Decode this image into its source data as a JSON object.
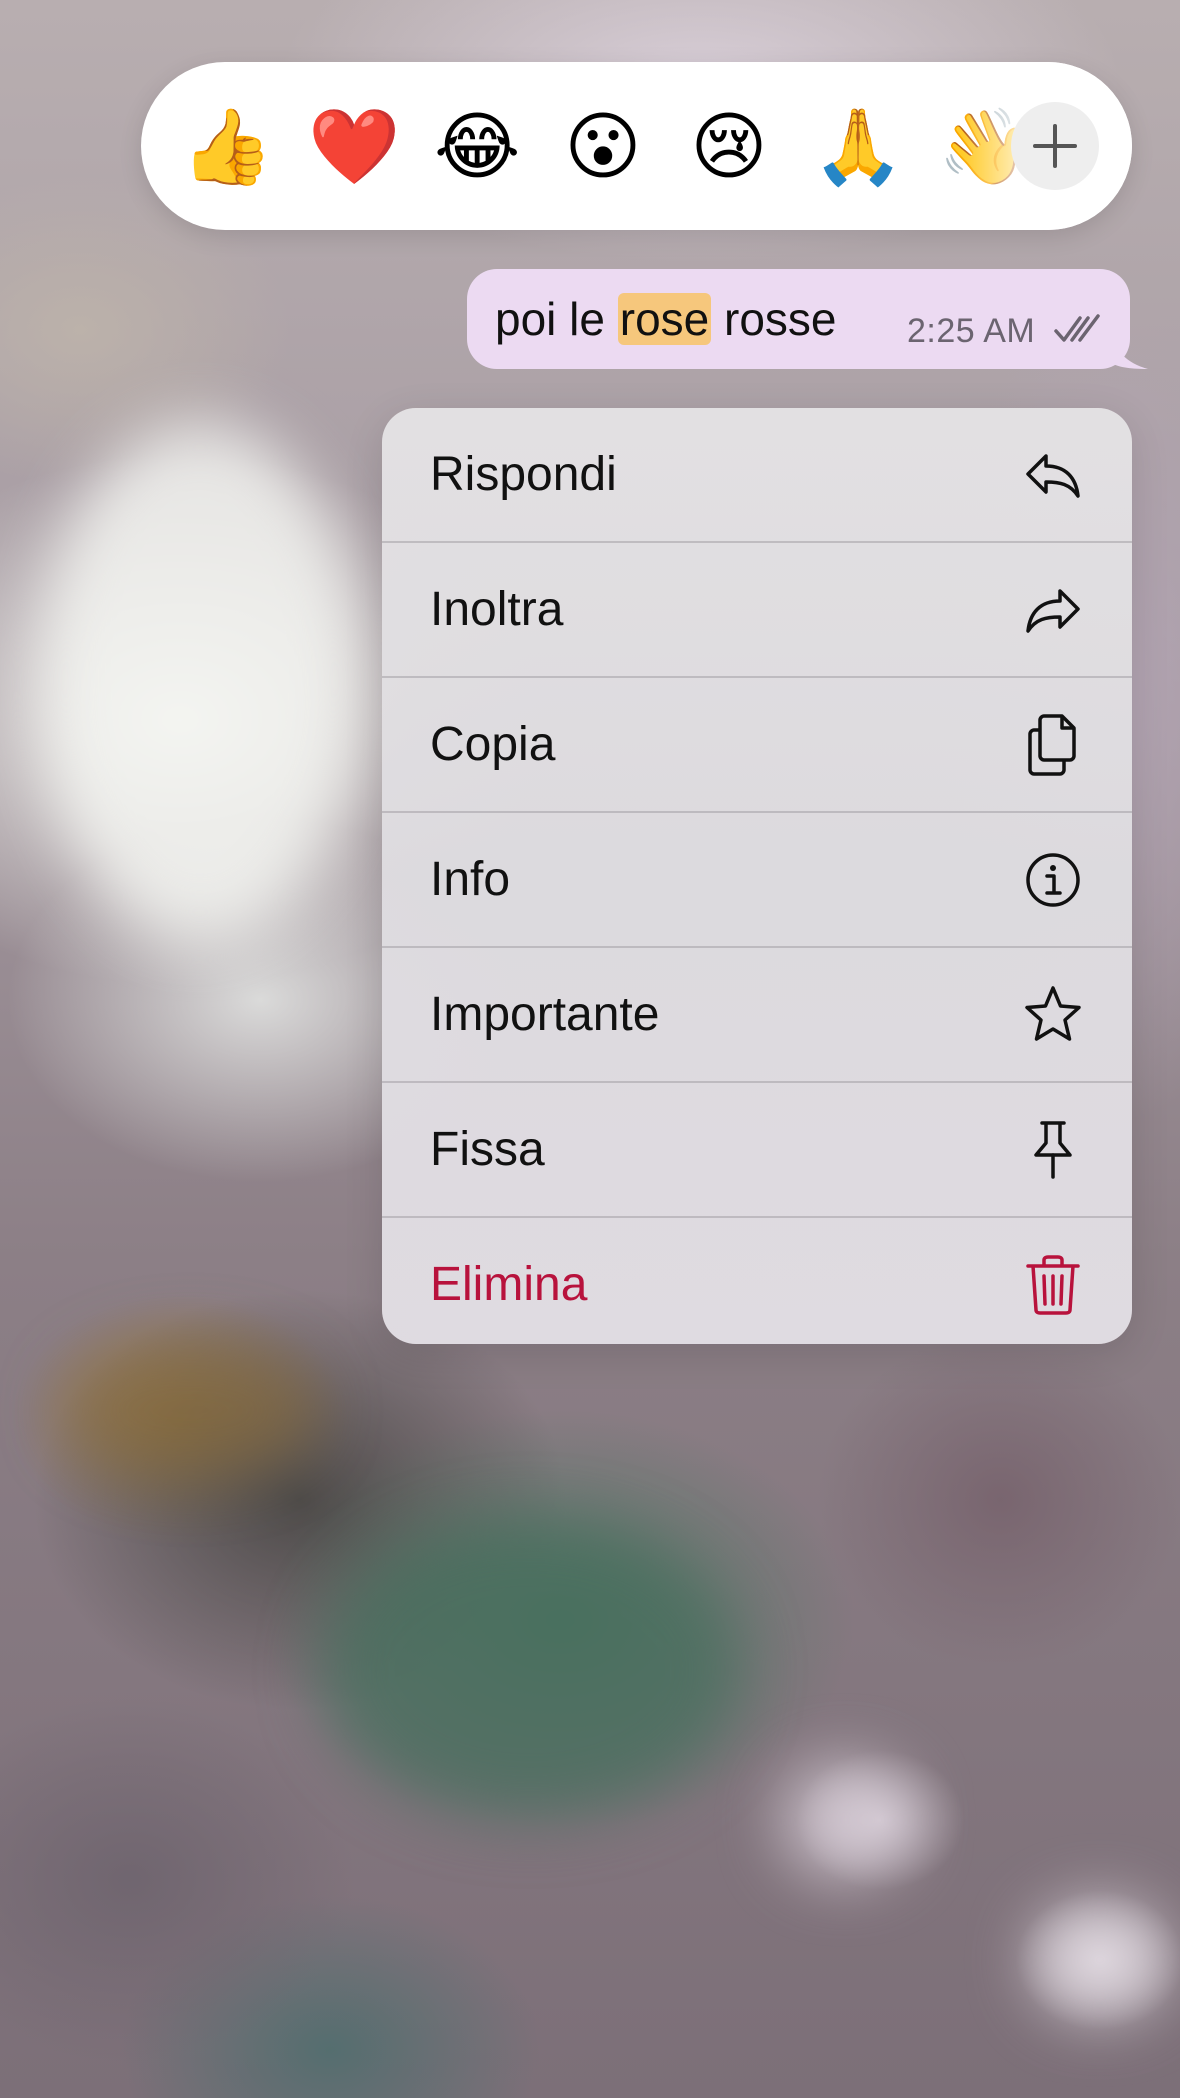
{
  "reactions": {
    "emojis": [
      {
        "name": "thumbs-up",
        "glyph": "👍"
      },
      {
        "name": "red-heart",
        "glyph": "❤️"
      },
      {
        "name": "tears-of-joy",
        "glyph": "😂"
      },
      {
        "name": "surprised-face",
        "glyph": "😮"
      },
      {
        "name": "crying-face",
        "glyph": "😢"
      },
      {
        "name": "folded-hands",
        "glyph": "🙏"
      },
      {
        "name": "waving-hand",
        "glyph": "👋"
      }
    ],
    "more_icon": "plus-icon"
  },
  "message": {
    "text_before": "poi le ",
    "highlight": "rose",
    "text_after": " rosse",
    "time": "2:25 AM",
    "status_icon": "double-check-icon",
    "bubble_color": "#ecdaf2",
    "highlight_color": "#f6c77c"
  },
  "menu": {
    "items": [
      {
        "label": "Rispondi",
        "icon": "reply-icon"
      },
      {
        "label": "Inoltra",
        "icon": "forward-icon"
      },
      {
        "label": "Copia",
        "icon": "copy-icon"
      },
      {
        "label": "Info",
        "icon": "info-icon"
      },
      {
        "label": "Importante",
        "icon": "star-icon"
      },
      {
        "label": "Fissa",
        "icon": "pin-icon"
      },
      {
        "label": "Elimina",
        "icon": "trash-icon",
        "destructive": true
      }
    ],
    "destructive_color": "#b8123c"
  }
}
